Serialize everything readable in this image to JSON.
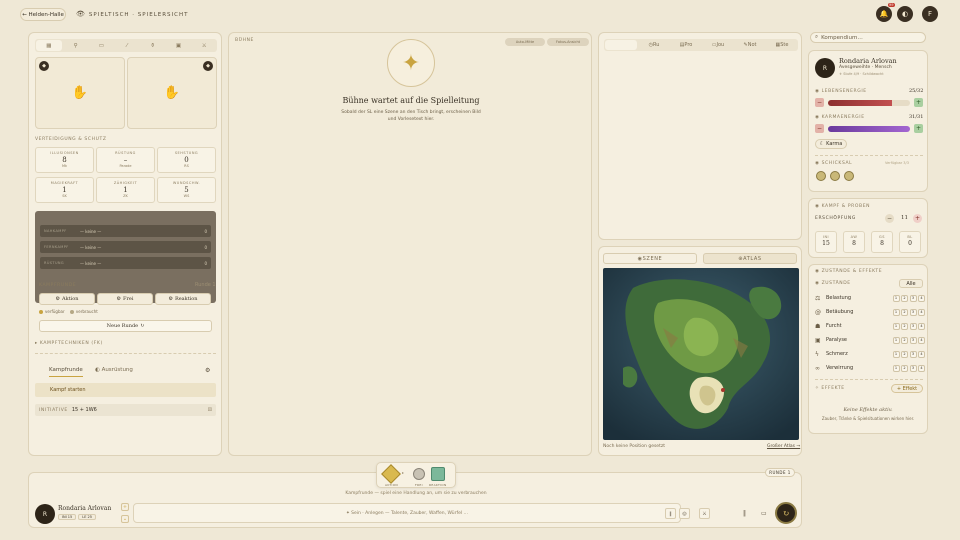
{
  "topbar": {
    "back_label": "← Helden-Halle",
    "title": "SPIELTISCH · SPIELERSICHT",
    "notif_count": "99",
    "avatar_initial": "F"
  },
  "left": {
    "tabs": [
      "",
      "",
      "",
      "",
      "",
      "",
      "",
      ""
    ],
    "defense_heading": "VERTEIDIGUNG & SCHUTZ",
    "stats": [
      {
        "label": "ILLUSIONSEN",
        "value": "8",
        "sub": "Mk"
      },
      {
        "label": "RÜSTUNG",
        "value": "–",
        "sub": "Parade"
      },
      {
        "label": "SEHSTUNG",
        "value": "0",
        "sub": "RS"
      },
      {
        "label": "MAGIEKRAFT",
        "value": "1",
        "sub": "SK"
      },
      {
        "label": "ZÄHIGKEIT",
        "value": "1",
        "sub": "ZK"
      },
      {
        "label": "WUNDSCHW.",
        "value": "5",
        "sub": "WS"
      }
    ],
    "gear_slots": [
      {
        "label": "NAHKAMPF",
        "value": "— keine —",
        "num": "0"
      },
      {
        "label": "FERNKAMPF",
        "value": "— keine —",
        "num": "0"
      },
      {
        "label": "RÜSTUNG",
        "value": "— keine —",
        "num": "0"
      }
    ],
    "combat_round_heading": "KAMPFRUNDE",
    "round_label": "Runde 1",
    "actions": [
      "Aktion",
      "Frei",
      "Reaktion"
    ],
    "legend": [
      "verfügbar",
      "verbraucht"
    ],
    "new_round": "Neue Runde",
    "techniques": "KAMPFTECHNIKEN (FK)",
    "subtabs": [
      "Kampfrunde",
      "Ausrüstung"
    ],
    "start_combat": "Kampf starten",
    "initiative_label": "INITIATIVE",
    "initiative_value": "15 + 1W6"
  },
  "stage": {
    "label": "BÜHNE",
    "chip_audio": "Auto-Mitte",
    "chip_focus": "Fokus-Ansicht",
    "title": "Bühne wartet auf die Spielleitung",
    "desc": "Sobald der SL eine Szene an den Tisch bringt, erscheinen Bild und Vorlesetext hier."
  },
  "notes": {
    "tabs": [
      "",
      "Ru",
      "Pro",
      "Jou",
      "Not",
      "Ste"
    ]
  },
  "map": {
    "tabs": [
      "SZENE",
      "ATLAS"
    ],
    "no_position": "Noch keine Position gesetzt",
    "larger_atlas": "Großer Atlas →"
  },
  "sidebar": {
    "search_placeholder": "Kompendium…",
    "char_name": "Rondaria Arlovan",
    "char_sub": "Avesgeweihte · Mensch",
    "char_meta": "⚜ Stufe 4/9 · Schildwacht",
    "avatar_initial": "R",
    "life_label": "LEBENSENERGIE",
    "life_value": "25/32",
    "life_fraction": 0.78,
    "karma_label": "KARMAENERGIE",
    "karma_value": "31/31",
    "karma_fraction": 1.0,
    "karma_btn": "Karma",
    "fate_label": "SCHICKSAL",
    "fate_link": "Verfügbar 3/3",
    "combat_heading": "KAMPF & PROBEN",
    "exhaustion_label": "ERSCHÖPFUNG",
    "exhaustion_value": "11",
    "ini_stats": [
      {
        "label": "INI",
        "value": "15"
      },
      {
        "label": "AW",
        "value": "8"
      },
      {
        "label": "GS",
        "value": "8"
      },
      {
        "label": "BL",
        "value": "0"
      }
    ],
    "conditions_heading": "ZUSTÄNDE & EFFEKTE",
    "conditions_label": "ZUSTÄNDE",
    "conditions_btn": "Alle",
    "conditions": [
      {
        "name": "Belastung",
        "icon": "scale-icon"
      },
      {
        "name": "Betäubung",
        "icon": "spiral-icon"
      },
      {
        "name": "Furcht",
        "icon": "ghost-icon"
      },
      {
        "name": "Paralyse",
        "icon": "lock-icon"
      },
      {
        "name": "Schmerz",
        "icon": "bolt-icon"
      },
      {
        "name": "Verwirrung",
        "icon": "swirl-icon"
      }
    ],
    "levels": [
      "1",
      "2",
      "3",
      "4"
    ],
    "effects_label": "EFFEKTE",
    "effects_btn": "+ Effekt",
    "no_effects": "Keine Effekte aktiv.",
    "no_effects_hint": "Zauber, Tränke & Spielsituationen wirken hier."
  },
  "dock": {
    "dice": [
      "AKTION",
      "FREI",
      "REAKTION"
    ],
    "round_btn": "RUNDE 1",
    "hint": "Kampfrunde — spiel eine Handlung an, um sie zu verbrauchen",
    "char_name": "Rondaria Arlovan",
    "chips": [
      "INI 15",
      "LE 25"
    ],
    "input_placeholder": "✦ Sein · Anlegen — Talente, Zauber, Waffen, Würfel …",
    "avatar_initial": "R"
  },
  "colors": {
    "accent": "#c9a441",
    "life": "#b23a3a",
    "karma": "#8e4fb8"
  }
}
